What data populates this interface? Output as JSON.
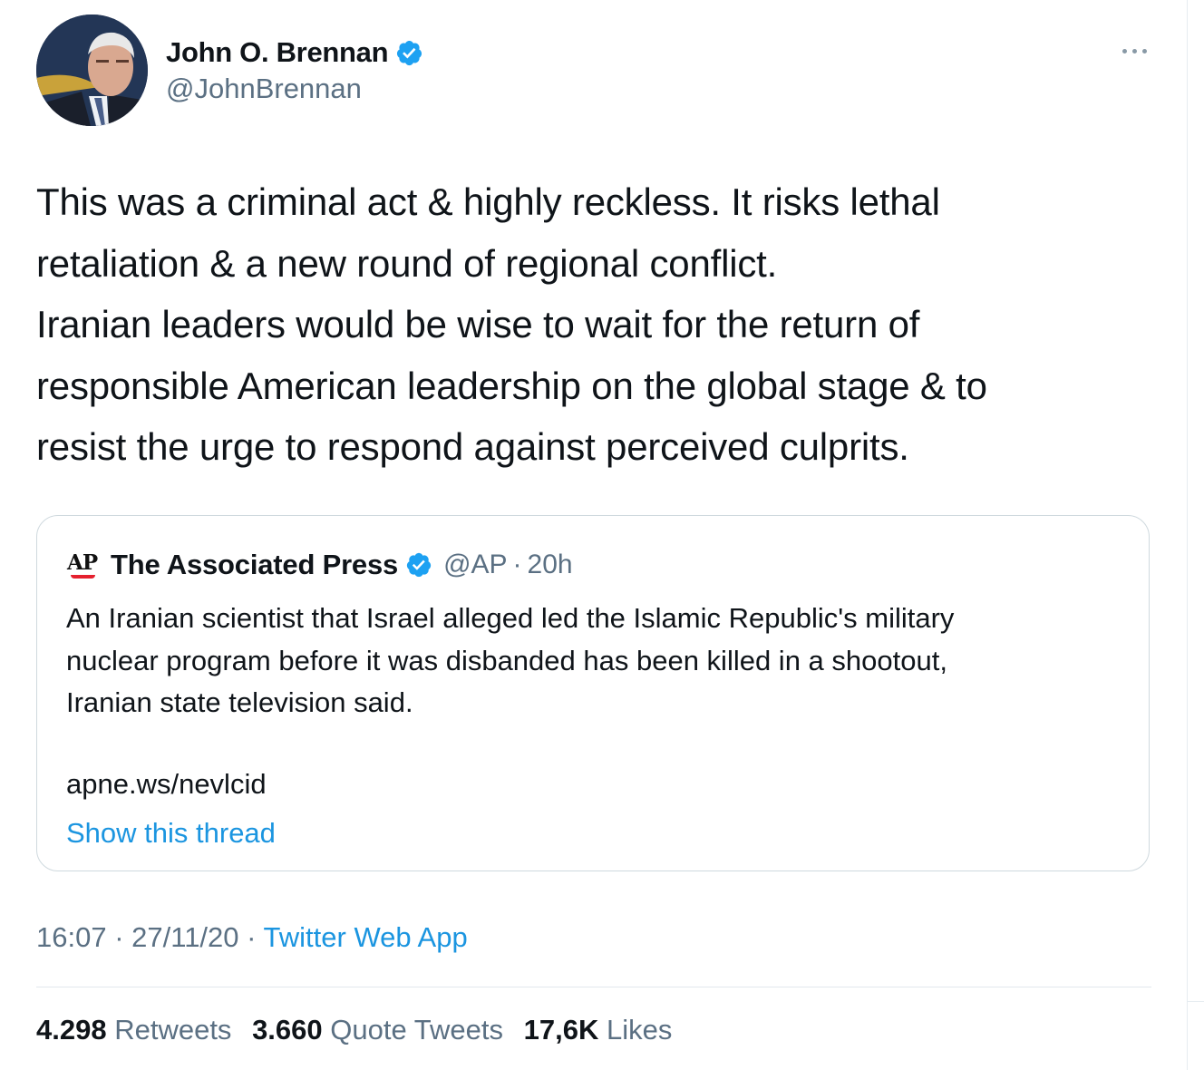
{
  "author": {
    "name": "John O. Brennan",
    "handle": "@JohnBrennan",
    "verified_icon": "verified-badge-icon",
    "badge_color": "#1da1f2"
  },
  "tweet": {
    "lines": [
      "This was a criminal act & highly reckless. It risks lethal",
      "retaliation & a new round of regional conflict.",
      "Iranian leaders would be wise to wait for the return of",
      "responsible American leadership on the global stage & to",
      "resist the urge to respond against perceived culprits."
    ]
  },
  "quote": {
    "logo_text": "AP",
    "name": "The Associated Press",
    "handle": "@AP",
    "separator": "·",
    "age": "20h",
    "lines": [
      "An Iranian scientist that Israel alleged led the Islamic Republic's military",
      "nuclear program before it was disbanded has been killed in a shootout,",
      "Iranian state television said."
    ],
    "link": "apne.ws/nevlcid",
    "show_thread": "Show this thread"
  },
  "meta": {
    "time": "16:07",
    "date": "27/11/20",
    "separator": "·",
    "source": "Twitter Web App"
  },
  "stats": {
    "retweets_count": "4.298",
    "retweets_label": "Retweets",
    "quotes_count": "3.660",
    "quotes_label": "Quote Tweets",
    "likes_count": "17,6K",
    "likes_label": "Likes"
  },
  "colors": {
    "link": "#1b95e0",
    "secondary_text": "#5b7083",
    "border": "#cfd9de"
  }
}
